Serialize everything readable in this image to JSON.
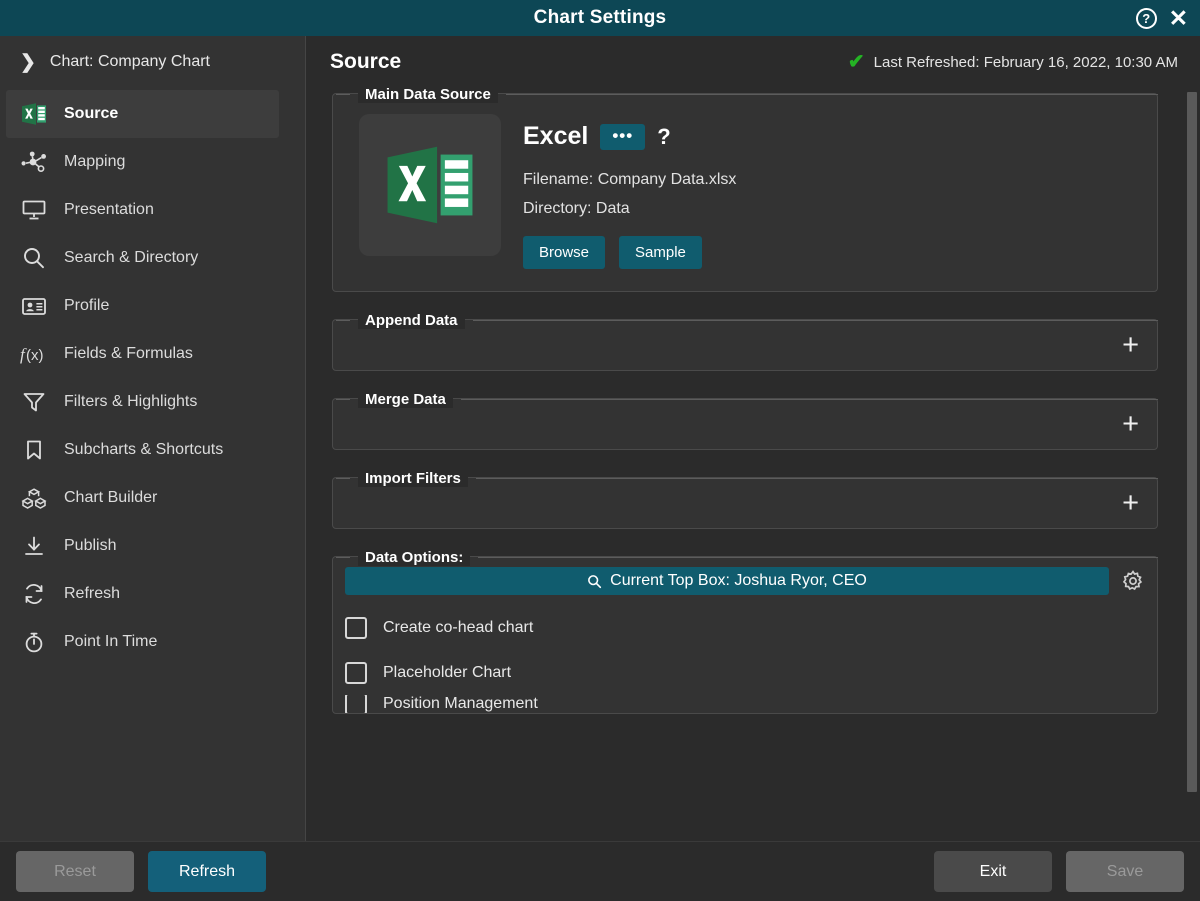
{
  "window": {
    "title": "Chart Settings",
    "help_icon": "help-circle-icon",
    "close_icon": "close-icon"
  },
  "sidebar": {
    "chart_label": "Chart: Company Chart",
    "chevron_icon": "chevron-right-icon",
    "items": [
      {
        "label": "Source",
        "icon": "excel-icon",
        "active": true
      },
      {
        "label": "Mapping",
        "icon": "mapping-nodes-icon",
        "active": false
      },
      {
        "label": "Presentation",
        "icon": "presentation-screen-icon",
        "active": false
      },
      {
        "label": "Search & Directory",
        "icon": "search-icon",
        "active": false
      },
      {
        "label": "Profile",
        "icon": "id-card-icon",
        "active": false
      },
      {
        "label": "Fields & Formulas",
        "icon": "function-fx-icon",
        "active": false
      },
      {
        "label": "Filters & Highlights",
        "icon": "funnel-filter-icon",
        "active": false
      },
      {
        "label": "Subcharts & Shortcuts",
        "icon": "bookmark-icon",
        "active": false
      },
      {
        "label": "Chart Builder",
        "icon": "blocks-cubes-icon",
        "active": false
      },
      {
        "label": "Publish",
        "icon": "download-publish-icon",
        "active": false
      },
      {
        "label": "Refresh",
        "icon": "refresh-cycle-icon",
        "active": false
      },
      {
        "label": "Point In Time",
        "icon": "stopwatch-icon",
        "active": false
      }
    ]
  },
  "content": {
    "title": "Source",
    "status": {
      "check_icon": "green-check-icon",
      "text": "Last Refreshed: February 16, 2022, 10:30 AM"
    },
    "main_data_source": {
      "legend": "Main Data Source",
      "tile_icon": "excel-file-icon",
      "source_name": "Excel",
      "more_button": "•••",
      "help_label": "?",
      "filename_label": "Filename:",
      "filename_value": "Company Data.xlsx",
      "directory_label": "Directory:",
      "directory_value": "Data",
      "browse_label": "Browse",
      "sample_label": "Sample"
    },
    "append_data": {
      "legend": "Append Data",
      "add_icon": "plus-icon"
    },
    "merge_data": {
      "legend": "Merge Data",
      "add_icon": "plus-icon"
    },
    "import_filters": {
      "legend": "Import Filters",
      "add_icon": "plus-icon"
    },
    "data_options": {
      "legend": "Data Options:",
      "search_icon": "search-icon",
      "search_value": "Current Top Box: Joshua Ryor, CEO",
      "gear_icon": "gear-icon",
      "checkboxes": [
        {
          "label": "Create co-head chart",
          "checked": false
        },
        {
          "label": "Placeholder Chart",
          "checked": false
        },
        {
          "label": "Position Management",
          "checked": false
        }
      ]
    },
    "scrollbar": "vertical-scrollbar"
  },
  "footer": {
    "reset_label": "Reset",
    "refresh_label": "Refresh",
    "exit_label": "Exit",
    "save_label": "Save"
  },
  "colors": {
    "titlebar": "#0d4755",
    "accent_teal": "#105c6e",
    "sidebar": "#333333",
    "content_bg": "#2b2b2b",
    "excel_green": "#217346",
    "check_green": "#24b324"
  }
}
